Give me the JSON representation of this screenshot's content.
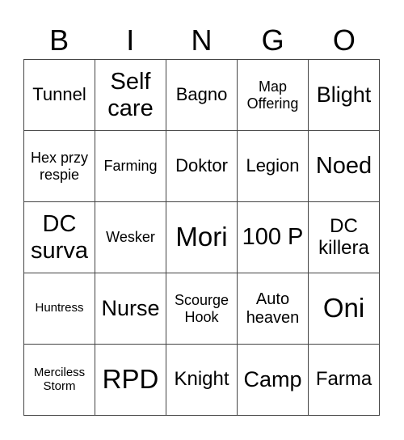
{
  "header": {
    "letters": [
      "B",
      "I",
      "N",
      "G",
      "O"
    ]
  },
  "board": {
    "cells": [
      "Tunnel",
      "Self care",
      "Bagno",
      "Map Offering",
      "Blight",
      "Hex przy respie",
      "Farming",
      "Doktor",
      "Legion",
      "Noed",
      "DC surva",
      "Wesker",
      "Mori",
      "100 P",
      "DC killera",
      "Huntress",
      "Nurse",
      "Scourge Hook",
      "Auto heaven",
      "Oni",
      "Merciless Storm",
      "RPD",
      "Knight",
      "Camp",
      "Farma"
    ]
  }
}
